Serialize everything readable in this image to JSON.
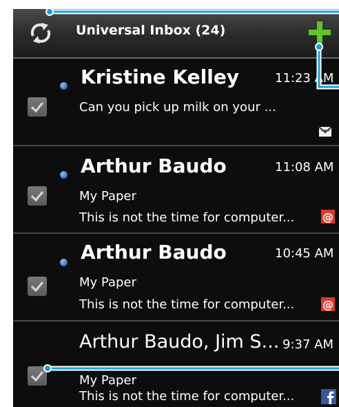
{
  "header": {
    "title": "Universal Inbox (24)",
    "refresh_icon": "refresh-icon",
    "compose_icon": "add-icon"
  },
  "messages": [
    {
      "sender": "Kristine Kelley",
      "time": "11:23 AM",
      "lines": [
        "Can you pick up milk on your ..."
      ],
      "unread": true,
      "account_icon": "envelope-icon",
      "checked": true
    },
    {
      "sender": "Arthur Baudo",
      "time": "11:08 AM",
      "lines": [
        "My Paper",
        "This is not the time for computer..."
      ],
      "unread": true,
      "account_icon": "email-at-icon",
      "checked": true
    },
    {
      "sender": "Arthur Baudo",
      "time": "10:45 AM",
      "lines": [
        "My Paper",
        "This is not the time for computer..."
      ],
      "unread": true,
      "account_icon": "email-at-icon",
      "checked": true
    },
    {
      "sender": "Arthur Baudo, Jim S...",
      "time": "9:37 AM",
      "lines": [
        "My Paper",
        "This is not the time for computer..."
      ],
      "unread": false,
      "account_icon": "facebook-icon",
      "checked": true
    }
  ],
  "colors": {
    "accent_green": "#5fc32a",
    "callout_blue": "#1c9fd6",
    "unread_dot": "#3b82d4",
    "email_icon_red": "#d93a2b",
    "facebook_blue": "#3b5998"
  }
}
